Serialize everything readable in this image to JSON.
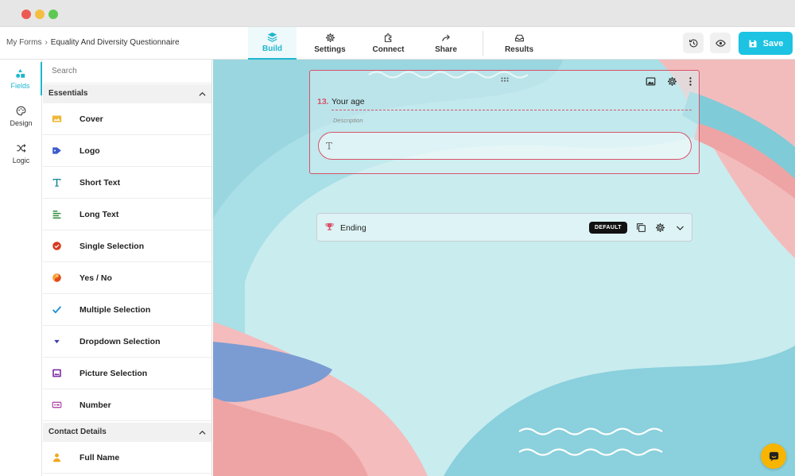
{
  "breadcrumb": {
    "root": "My Forms",
    "separator": "›",
    "current": "Equality And Diversity Questionnaire"
  },
  "nav": {
    "tabs": [
      {
        "label": "Build",
        "icon": "layers-icon",
        "active": true
      },
      {
        "label": "Settings",
        "icon": "gear-icon"
      },
      {
        "label": "Connect",
        "icon": "puzzle-icon"
      },
      {
        "label": "Share",
        "icon": "share-arrow-icon"
      },
      {
        "label": "Results",
        "icon": "inbox-icon"
      }
    ],
    "save_label": "Save"
  },
  "rail": [
    {
      "label": "Fields",
      "icon": "shapes-icon",
      "active": true
    },
    {
      "label": "Design",
      "icon": "palette-icon"
    },
    {
      "label": "Logic",
      "icon": "shuffle-icon"
    }
  ],
  "panel": {
    "search_placeholder": "Search",
    "sections": [
      {
        "title": "Essentials",
        "items": [
          {
            "label": "Cover",
            "icon": "cover-image-icon",
            "color": "#f0b73a"
          },
          {
            "label": "Logo",
            "icon": "tag-icon",
            "color": "#3b5bcc"
          },
          {
            "label": "Short Text",
            "icon": "text-t-icon",
            "color": "#1d8a96"
          },
          {
            "label": "Long Text",
            "icon": "long-text-icon",
            "color": "#2e8b3a"
          },
          {
            "label": "Single Selection",
            "icon": "check-circle-icon",
            "color": "#d9391f"
          },
          {
            "label": "Yes / No",
            "icon": "yes-no-icon",
            "color": "#e24a1c"
          },
          {
            "label": "Multiple Selection",
            "icon": "checkmark-icon",
            "color": "#1e8fd0"
          },
          {
            "label": "Dropdown Selection",
            "icon": "dropdown-icon",
            "color": "#3c3ab0"
          },
          {
            "label": "Picture Selection",
            "icon": "picture-icon",
            "color": "#7b2fa3"
          },
          {
            "label": "Number",
            "icon": "number-icon",
            "color": "#a63aa0"
          }
        ]
      },
      {
        "title": "Contact Details",
        "items": [
          {
            "label": "Full Name",
            "icon": "person-icon",
            "color": "#f0a91e"
          }
        ]
      }
    ]
  },
  "canvas": {
    "question": {
      "number": "13.",
      "title": "Your age",
      "description": "Description",
      "input_icon": "T"
    },
    "ending": {
      "label": "Ending",
      "badge": "DEFAULT"
    }
  },
  "colors": {
    "accent": "#1cc3e2",
    "question_border": "#d9526a",
    "canvas_teal": "#a9dfe6",
    "canvas_pink": "#eeaaa9",
    "canvas_blue": "#7b9cd3"
  }
}
